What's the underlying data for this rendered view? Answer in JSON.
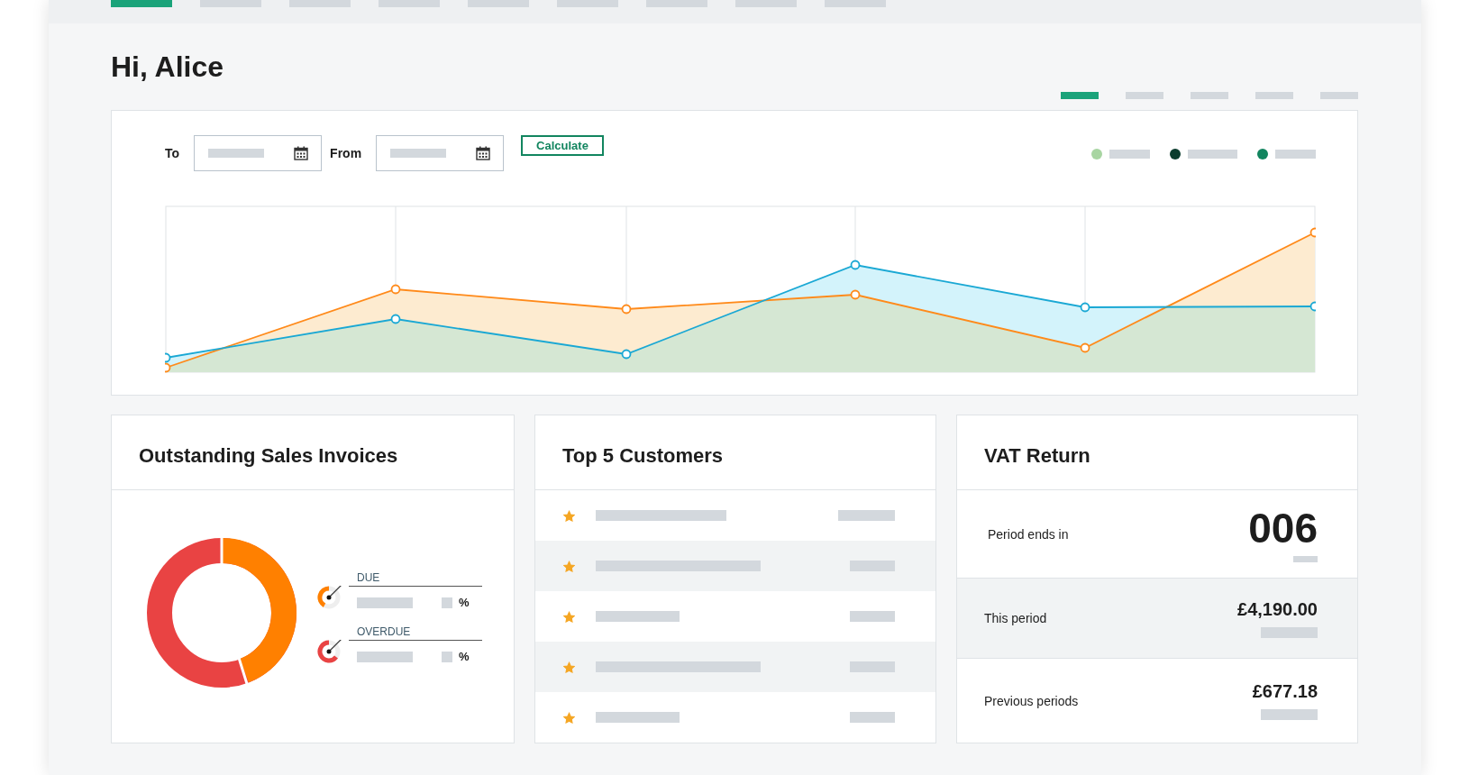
{
  "top_tabs": [
    {
      "selected": true
    },
    {
      "selected": false
    },
    {
      "selected": false
    },
    {
      "selected": false
    },
    {
      "selected": false
    },
    {
      "selected": false
    },
    {
      "selected": false
    },
    {
      "selected": false
    },
    {
      "selected": false
    }
  ],
  "greeting": "Hi, Alice",
  "sub_tabs": [
    {
      "selected": true
    },
    {
      "selected": false
    },
    {
      "selected": false
    },
    {
      "selected": false
    },
    {
      "selected": false
    }
  ],
  "chart_card": {
    "to_label": "To",
    "from_label": "From",
    "calculate_button": "Calculate",
    "legend": [
      {
        "color": "#a8d5a2"
      },
      {
        "color": "#0b3d2e"
      },
      {
        "color": "#12855f"
      }
    ]
  },
  "outstanding": {
    "title": "Outstanding Sales Invoices",
    "items": [
      {
        "kind": "due",
        "label": "DUE",
        "unit": "%"
      },
      {
        "kind": "overdue",
        "label": "OVERDUE",
        "unit": "%"
      }
    ]
  },
  "top_customers": {
    "title": "Top 5 Customers",
    "rows": [
      {
        "starred": true
      },
      {
        "starred": true
      },
      {
        "starred": true
      },
      {
        "starred": true
      },
      {
        "starred": true
      }
    ]
  },
  "vat": {
    "title": "VAT Return",
    "period_label": "Period ends in",
    "period_value": "006",
    "rows": [
      {
        "label": "This period",
        "value": "£4,190.00",
        "selected": true
      },
      {
        "label": "Previous periods",
        "value": "£677.18",
        "selected": false
      }
    ]
  }
}
